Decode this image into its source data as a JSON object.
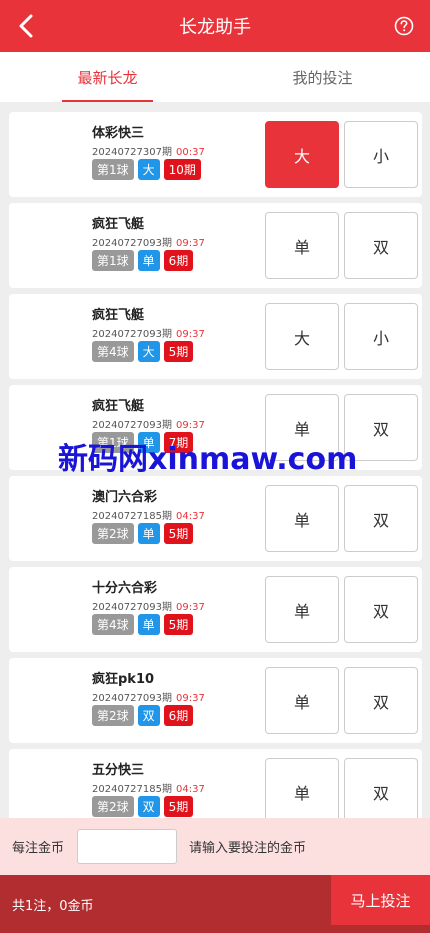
{
  "header": {
    "title": "长龙助手",
    "back_icon": "chevron-left-icon",
    "help_icon": "question-circle-icon"
  },
  "tabs": [
    {
      "label": "最新长龙",
      "active": true
    },
    {
      "label": "我的投注",
      "active": false
    }
  ],
  "cards": [
    {
      "name": "体彩快三",
      "period": "20240727307期",
      "time": "00:37",
      "ball": "第1球",
      "result": "大",
      "streak": "10期",
      "options": [
        "大",
        "小"
      ],
      "selected": 0
    },
    {
      "name": "疯狂飞艇",
      "period": "20240727093期",
      "time": "09:37",
      "ball": "第1球",
      "result": "单",
      "streak": "6期",
      "options": [
        "单",
        "双"
      ],
      "selected": -1
    },
    {
      "name": "疯狂飞艇",
      "period": "20240727093期",
      "time": "09:37",
      "ball": "第4球",
      "result": "大",
      "streak": "5期",
      "options": [
        "大",
        "小"
      ],
      "selected": -1
    },
    {
      "name": "疯狂飞艇",
      "period": "20240727093期",
      "time": "09:37",
      "ball": "第1球",
      "result": "单",
      "streak": "7期",
      "options": [
        "单",
        "双"
      ],
      "selected": -1
    },
    {
      "name": "澳门六合彩",
      "period": "20240727185期",
      "time": "04:37",
      "ball": "第2球",
      "result": "单",
      "streak": "5期",
      "options": [
        "单",
        "双"
      ],
      "selected": -1
    },
    {
      "name": "十分六合彩",
      "period": "20240727093期",
      "time": "09:37",
      "ball": "第4球",
      "result": "单",
      "streak": "5期",
      "options": [
        "单",
        "双"
      ],
      "selected": -1
    },
    {
      "name": "疯狂pk10",
      "period": "20240727093期",
      "time": "09:37",
      "ball": "第2球",
      "result": "双",
      "streak": "6期",
      "options": [
        "单",
        "双"
      ],
      "selected": -1
    },
    {
      "name": "五分快三",
      "period": "20240727185期",
      "time": "04:37",
      "ball": "第2球",
      "result": "双",
      "streak": "5期",
      "options": [
        "单",
        "双"
      ],
      "selected": -1
    }
  ],
  "watermark": "新码网xinmaw.com",
  "bet": {
    "label": "每注金币",
    "input_value": "",
    "hint": "请输入要投注的金币"
  },
  "footer": {
    "summary": "共1注，0金币",
    "submit_label": "马上投注"
  },
  "colors": {
    "accent": "#e8333a",
    "tag_gray": "#999999",
    "tag_blue": "#2196e8",
    "tag_red": "#e0121b",
    "footer": "#b22d2f"
  }
}
